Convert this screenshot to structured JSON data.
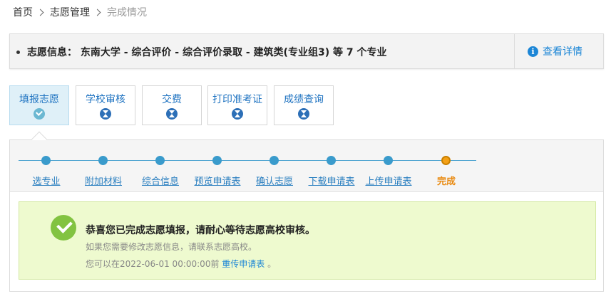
{
  "breadcrumb": {
    "items": [
      "首页",
      "志愿管理",
      "完成情况"
    ]
  },
  "info_bar": {
    "text": "志愿信息： 东南大学 - 综合评价 - 综合评价录取 - 建筑类(专业组3) 等 7 个专业",
    "detail_icon": "info-icon",
    "detail_label": "查看详情"
  },
  "tabs": [
    {
      "label": "填报志愿",
      "status": "done",
      "icon": "check-icon"
    },
    {
      "label": "学校审核",
      "status": "pending",
      "icon": "hourglass-icon"
    },
    {
      "label": "交费",
      "status": "pending",
      "icon": "hourglass-icon"
    },
    {
      "label": "打印准考证",
      "status": "pending",
      "icon": "hourglass-icon"
    },
    {
      "label": "成绩查询",
      "status": "pending",
      "icon": "hourglass-icon"
    }
  ],
  "steps": [
    {
      "label": "选专业",
      "current": false
    },
    {
      "label": "附加材料",
      "current": false
    },
    {
      "label": "综合信息",
      "current": false
    },
    {
      "label": "预览申请表",
      "current": false
    },
    {
      "label": "确认志愿",
      "current": false
    },
    {
      "label": "下载申请表",
      "current": false
    },
    {
      "label": "上传申请表",
      "current": false
    },
    {
      "label": "完成",
      "current": true
    }
  ],
  "success": {
    "icon": "check-circle-icon",
    "title": "恭喜您已完成志愿填报，请耐心等待志愿高校审核。",
    "subtitle": "如果您需要修改志愿信息，请联系志愿高校。",
    "line3_prefix": "您可以在2022-06-01 00:00:00前",
    "line3_link": "重传申请表",
    "line3_suffix": "。"
  },
  "colors": {
    "accent": "#1c86d6",
    "step_blue": "#3a9bcc",
    "current_orange": "#f4a015",
    "success_bg": "#eefacf",
    "success_green": "#82c341"
  }
}
